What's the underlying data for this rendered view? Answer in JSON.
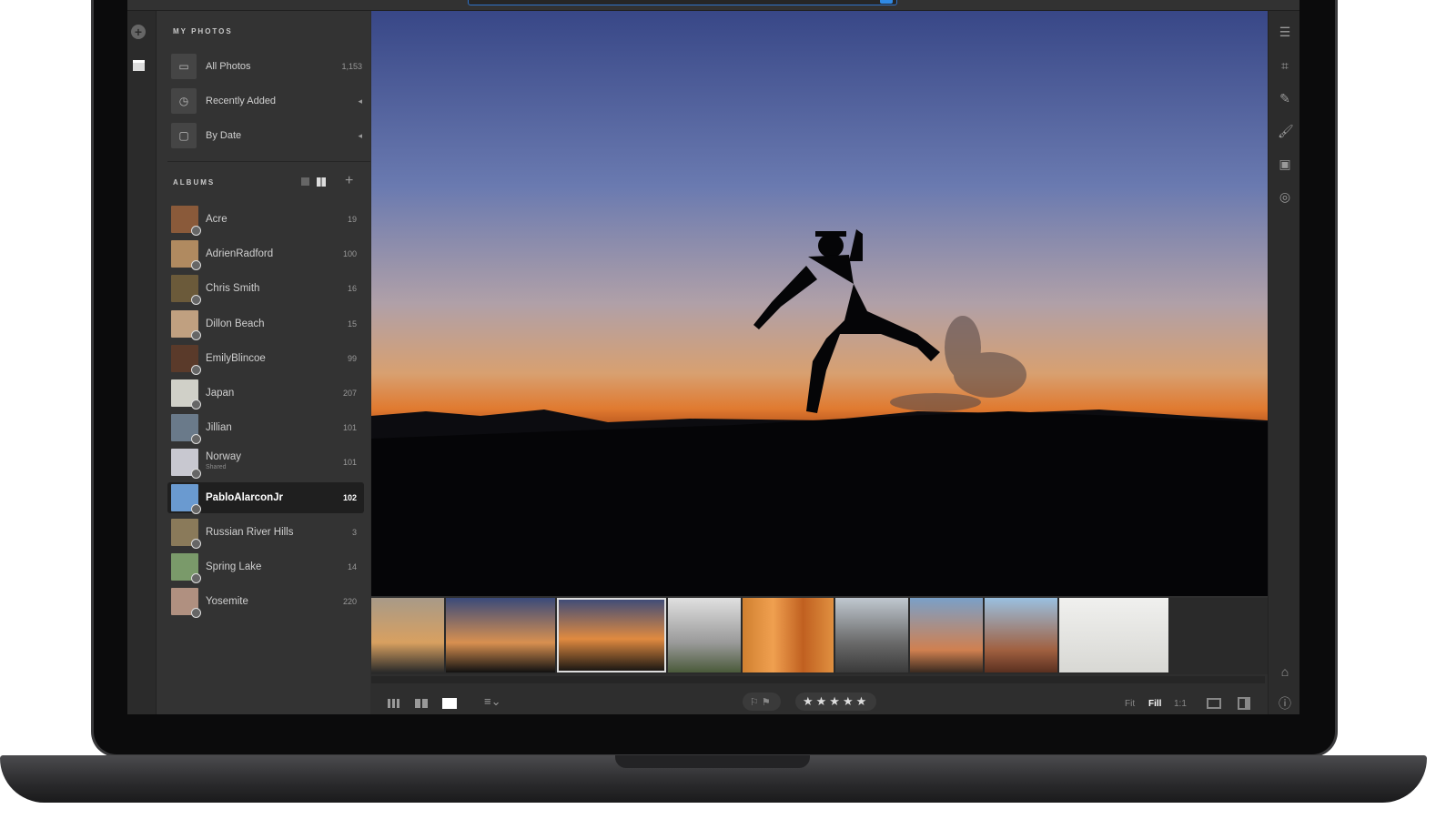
{
  "my_photos": {
    "title": "MY PHOTOS",
    "items": [
      {
        "label": "All Photos",
        "count": "1,153",
        "icon": "image-icon"
      },
      {
        "label": "Recently Added",
        "icon": "clock-icon"
      },
      {
        "label": "By Date",
        "icon": "calendar-icon"
      }
    ]
  },
  "albums": {
    "title": "ALBUMS",
    "items": [
      {
        "name": "Acre",
        "count": "19",
        "color": "#8a5a3a"
      },
      {
        "name": "AdrienRadford",
        "count": "100",
        "color": "#b08a60"
      },
      {
        "name": "Chris Smith",
        "count": "16",
        "color": "#6b5a3a"
      },
      {
        "name": "Dillon Beach",
        "count": "15",
        "color": "#c0a080"
      },
      {
        "name": "EmilyBlincoe",
        "count": "99",
        "color": "#5a3a2a"
      },
      {
        "name": "Japan",
        "count": "207",
        "color": "#d0d0c8"
      },
      {
        "name": "Jillian",
        "count": "101",
        "color": "#6a7a8a"
      },
      {
        "name": "Norway",
        "sub": "Shared",
        "count": "101",
        "color": "#c8c8d0"
      },
      {
        "name": "PabloAlarconJr",
        "count": "102",
        "color": "#6a9ad0",
        "selected": true
      },
      {
        "name": "Russian River Hills",
        "count": "3",
        "color": "#8a7a5a"
      },
      {
        "name": "Spring Lake",
        "count": "14",
        "color": "#7a9a6a"
      },
      {
        "name": "Yosemite",
        "count": "220",
        "color": "#b09080"
      }
    ]
  },
  "filmstrip": [
    {
      "color": "linear-gradient(#a89a88,#d8a060 60%,#2a2a2a)"
    },
    {
      "color": "linear-gradient(#3a4a7a,#d89050 60%,#111)"
    },
    {
      "color": "linear-gradient(#3a4a7a,#e08a40 55%,#111)",
      "selected": true
    },
    {
      "color": "linear-gradient(#e0e0e0,#9a9a9a 60%,#4a5a3a)"
    },
    {
      "color": "linear-gradient(90deg,#d08030,#f0a050,#c06020,#e09040)"
    },
    {
      "color": "linear-gradient(#c0c8d0,#6a6a6a 60%,#3a3a3a)"
    },
    {
      "color": "linear-gradient(#7aa0c8,#d08050 70%,#3a2a20)"
    },
    {
      "color": "linear-gradient(#9ac0e0,#a06040 70%,#5a3020)"
    },
    {
      "color": "linear-gradient(#f0f0ee,#d8d8d4)"
    }
  ],
  "toolbar": {
    "stars": "★★★★★",
    "flags": "⚐⚑",
    "fit": "Fit",
    "fill": "Fill",
    "one_to_one": "1:1"
  },
  "photo": {
    "sky_top": "#3a4a8a",
    "horizon": "#e07a30"
  }
}
